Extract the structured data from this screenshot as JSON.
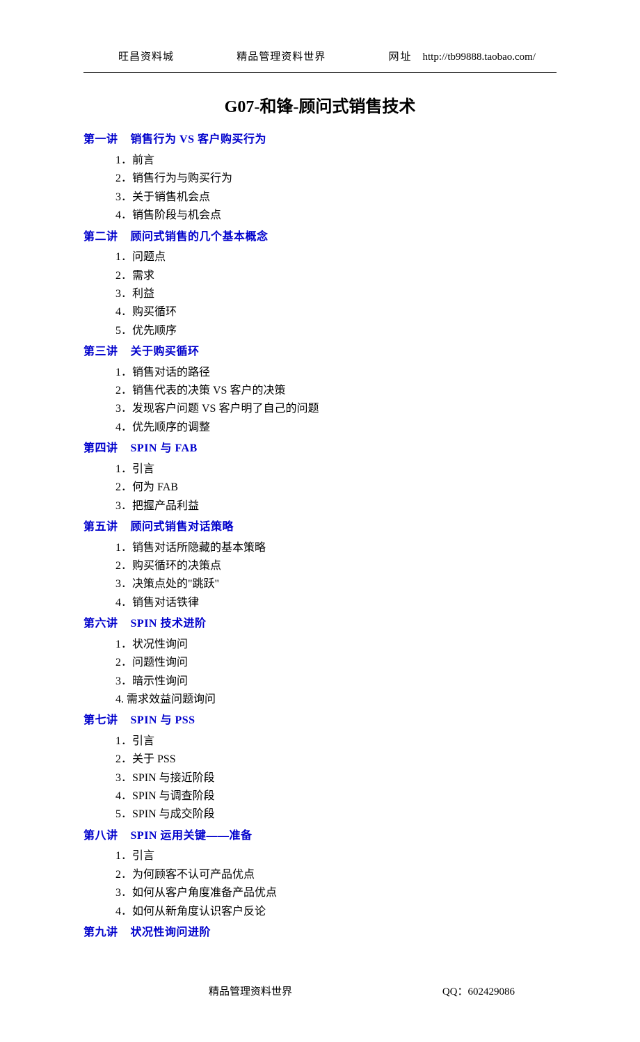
{
  "header": {
    "left": "旺昌资料城",
    "center": "精品管理资料世界",
    "right_label": "网址",
    "url": "http://tb99888.taobao.com/"
  },
  "title": "G07-和锋-顾问式销售技术",
  "sections": [
    {
      "heading_pre": "第一讲",
      "heading": "销售行为 VS 客户购买行为",
      "items": [
        "1．前言",
        "2．销售行为与购买行为",
        "3．关于销售机会点",
        "4．销售阶段与机会点"
      ]
    },
    {
      "heading_pre": "第二讲",
      "heading": "顾问式销售的几个基本概念",
      "items": [
        "1．问题点",
        "2．需求",
        "3．利益",
        "4．购买循环",
        "5．优先顺序"
      ]
    },
    {
      "heading_pre": "第三讲",
      "heading": "关于购买循环",
      "items": [
        "1．销售对话的路径",
        "2．销售代表的决策 VS 客户的决策",
        "3．发现客户问题 VS 客户明了自己的问题",
        "4．优先顺序的调整"
      ]
    },
    {
      "heading_pre": "第四讲",
      "heading": "SPIN 与 FAB",
      "items": [
        "1．引言",
        "2．何为 FAB",
        "3．把握产品利益"
      ]
    },
    {
      "heading_pre": "第五讲",
      "heading": "顾问式销售对话策略",
      "items": [
        "1．销售对话所隐藏的基本策略",
        "2．购买循环的决策点",
        "3．决策点处的\"跳跃\"",
        "4．销售对话铁律"
      ]
    },
    {
      "heading_pre": "第六讲",
      "heading": "SPIN 技术进阶",
      "items": [
        "1．状况性询问",
        "2．问题性询问",
        "3．暗示性询问",
        "4. 需求效益问题询问"
      ]
    },
    {
      "heading_pre": "第七讲",
      "heading": "SPIN 与 PSS",
      "items": [
        "1．引言",
        "2．关于 PSS",
        "3．SPIN 与接近阶段",
        "4．SPIN 与调查阶段",
        "5．SPIN 与成交阶段"
      ]
    },
    {
      "heading_pre": "第八讲",
      "heading": "SPIN 运用关键――准备",
      "items": [
        "1．引言",
        "2．为何顾客不认可产品优点",
        "3．如何从客户角度准备产品优点",
        "4．如何从新角度认识客户反论"
      ]
    },
    {
      "heading_pre": "第九讲",
      "heading": "状况性询问进阶",
      "items": []
    }
  ],
  "footer": {
    "left": "精品管理资料世界",
    "right_label": "QQ：",
    "right_value": "602429086"
  }
}
